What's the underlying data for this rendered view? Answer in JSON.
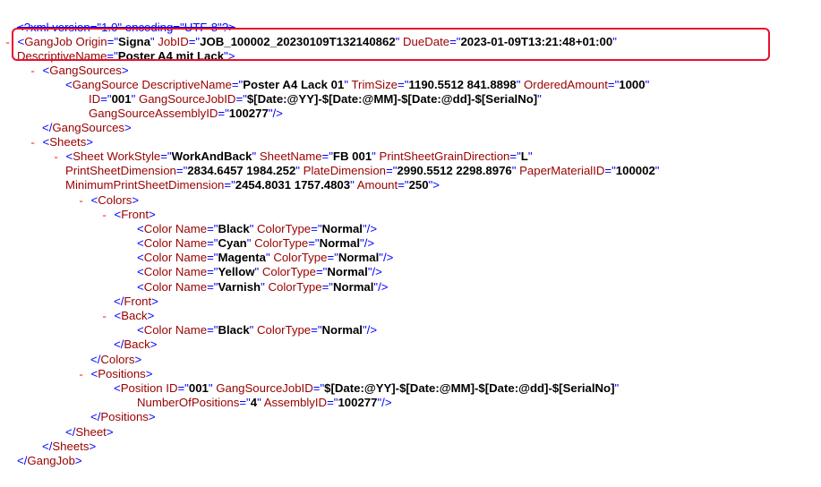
{
  "prolog": "<?xml version=\"1.0\" encoding=\"UTF-8\"?>",
  "toggle": "-",
  "tags": {
    "GangJob": "GangJob",
    "GangSources": "GangSources",
    "GangSource": "GangSource",
    "Sheets": "Sheets",
    "Sheet": "Sheet",
    "Colors": "Colors",
    "Front": "Front",
    "Back": "Back",
    "Color": "Color",
    "Positions": "Positions",
    "Position": "Position"
  },
  "attrs": {
    "Origin": "Origin",
    "JobID": "JobID",
    "DueDate": "DueDate",
    "DescriptiveName": "DescriptiveName",
    "TrimSize": "TrimSize",
    "OrderedAmount": "OrderedAmount",
    "ID": "ID",
    "GangSourceJobID": "GangSourceJobID",
    "GangSourceAssemblyID": "GangSourceAssemblyID",
    "WorkStyle": "WorkStyle",
    "SheetName": "SheetName",
    "PrintSheetGrainDirection": "PrintSheetGrainDirection",
    "PrintSheetDimension": "PrintSheetDimension",
    "PlateDimension": "PlateDimension",
    "PaperMaterialID": "PaperMaterialID",
    "MinimumPrintSheetDimension": "MinimumPrintSheetDimension",
    "Amount": "Amount",
    "Name": "Name",
    "ColorType": "ColorType",
    "NumberOfPositions": "NumberOfPositions",
    "AssemblyID": "AssemblyID"
  },
  "gangjob": {
    "origin": "Signa",
    "job_id": "JOB_100002_20230109T132140862",
    "due_date": "2023-01-09T13:21:48+01:00",
    "descriptive_name": "Poster A4 mit Lack"
  },
  "gangsource": {
    "descriptive_name": "Poster A4 Lack 01",
    "trim_size": "1190.5512 841.8898",
    "ordered_amount": "1000",
    "id": "001",
    "job_id": "$[Date:@YY]-$[Date:@MM]-$[Date:@dd]-$[SerialNo]",
    "assembly_id": "100277"
  },
  "sheet": {
    "work_style": "WorkAndBack",
    "sheet_name": "FB 001",
    "grain_direction": "L",
    "print_sheet_dimension": "2834.6457 1984.252",
    "plate_dimension": "2990.5512 2298.8976",
    "paper_material_id": "100002",
    "min_print_sheet_dimension": "2454.8031 1757.4803",
    "amount": "250"
  },
  "front_colors": [
    {
      "name": "Black",
      "type": "Normal"
    },
    {
      "name": "Cyan",
      "type": "Normal"
    },
    {
      "name": "Magenta",
      "type": "Normal"
    },
    {
      "name": "Yellow",
      "type": "Normal"
    },
    {
      "name": "Varnish",
      "type": "Normal"
    }
  ],
  "back_colors": [
    {
      "name": "Black",
      "type": "Normal"
    }
  ],
  "position": {
    "id": "001",
    "job_id": "$[Date:@YY]-$[Date:@MM]-$[Date:@dd]-$[SerialNo]",
    "number_of_positions": "4",
    "assembly_id": "100277"
  }
}
